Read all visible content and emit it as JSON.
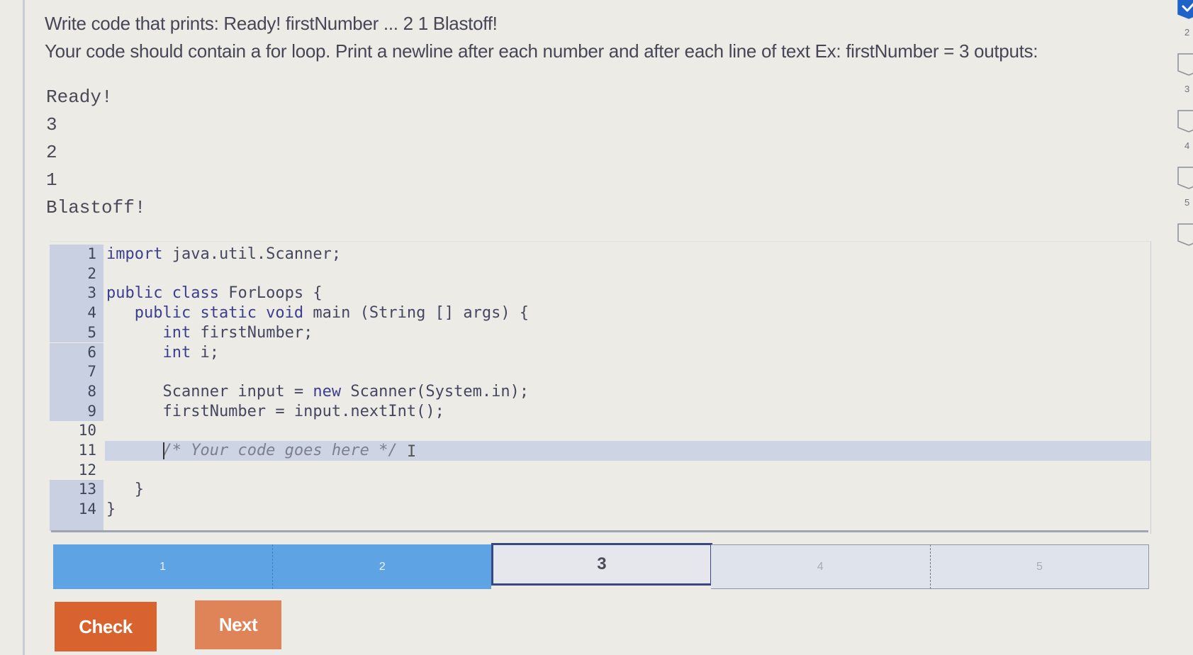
{
  "prompt": {
    "line1": "Write code that prints: Ready! firstNumber ... 2 1 Blastoff!",
    "line2": "Your code should contain a for loop. Print a newline after each number and after each line of text Ex: firstNumber = 3 outputs:"
  },
  "sample_output": [
    "Ready!",
    "3",
    "2",
    "1",
    "Blastoff!"
  ],
  "editor": {
    "lines": [
      {
        "n": "1",
        "editable": false,
        "tokens": [
          {
            "t": "import",
            "k": "kw"
          },
          {
            "t": " java.util.Scanner;"
          }
        ]
      },
      {
        "n": "2",
        "editable": false,
        "tokens": []
      },
      {
        "n": "3",
        "editable": false,
        "tokens": [
          {
            "t": "public class",
            "k": "kw"
          },
          {
            "t": " ForLoops {"
          }
        ]
      },
      {
        "n": "4",
        "editable": false,
        "tokens": [
          {
            "t": "   "
          },
          {
            "t": "public static void",
            "k": "kw"
          },
          {
            "t": " main (String [] args) {"
          }
        ]
      },
      {
        "n": "5",
        "editable": false,
        "tokens": [
          {
            "t": "      "
          },
          {
            "t": "int",
            "k": "kw"
          },
          {
            "t": " firstNumber;"
          }
        ]
      },
      {
        "n": "6",
        "editable": false,
        "tokens": [
          {
            "t": "      "
          },
          {
            "t": "int",
            "k": "kw"
          },
          {
            "t": " i;"
          }
        ]
      },
      {
        "n": "7",
        "editable": false,
        "tokens": []
      },
      {
        "n": "8",
        "editable": false,
        "tokens": [
          {
            "t": "      Scanner input = "
          },
          {
            "t": "new",
            "k": "kw"
          },
          {
            "t": " Scanner(System.in);"
          }
        ]
      },
      {
        "n": "9",
        "editable": false,
        "tokens": [
          {
            "t": "      firstNumber = input.nextInt();"
          }
        ]
      },
      {
        "n": "10",
        "editable": true,
        "tokens": []
      },
      {
        "n": "11",
        "editable": true,
        "active": true,
        "tokens": [
          {
            "t": "      "
          },
          {
            "t": "/* Your code goes here */",
            "k": "cm"
          }
        ]
      },
      {
        "n": "12",
        "editable": true,
        "tokens": []
      },
      {
        "n": "13",
        "editable": false,
        "tokens": [
          {
            "t": "   }"
          }
        ]
      },
      {
        "n": "14",
        "editable": false,
        "tokens": [
          {
            "t": "}"
          }
        ]
      }
    ]
  },
  "progress": {
    "current": 3,
    "segments": [
      {
        "label": "1",
        "state": "done"
      },
      {
        "label": "2",
        "state": "done"
      },
      {
        "label": "3",
        "state": "current"
      },
      {
        "label": "4",
        "state": "todo"
      },
      {
        "label": "5",
        "state": "todo"
      }
    ]
  },
  "buttons": {
    "check": "Check",
    "next": "Next"
  },
  "side_progress": {
    "items": [
      {
        "label": "1",
        "completed": true
      },
      {
        "label": "2",
        "completed": false
      },
      {
        "label": "3",
        "completed": false
      },
      {
        "label": "4",
        "completed": false
      },
      {
        "label": "5",
        "completed": false
      }
    ],
    "completed_color": "#1f63c9"
  },
  "colors": {
    "done_segment": "#5ea3e4",
    "current_border": "#3b4785",
    "check_button": "#d9632e",
    "next_button": "#df8358"
  }
}
